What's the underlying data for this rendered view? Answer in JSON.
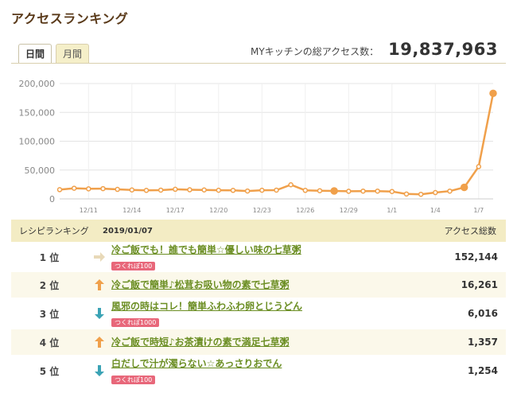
{
  "page": {
    "title": "アクセスランキング"
  },
  "tabs": [
    {
      "label": "日間",
      "active": true
    },
    {
      "label": "月間",
      "active": false
    }
  ],
  "total": {
    "label": "MYキッチンの総アクセス数：",
    "value": "19,837,963"
  },
  "chart_data": {
    "type": "line",
    "title": "",
    "xlabel": "",
    "ylabel": "",
    "ylim": [
      0,
      200000
    ],
    "yticks": [
      "0",
      "50,000",
      "100,000",
      "150,000",
      "200,000"
    ],
    "xtick_labels": [
      "12/11",
      "12/14",
      "12/17",
      "12/20",
      "12/23",
      "12/26",
      "12/29",
      "1/1",
      "1/4",
      "1/7"
    ],
    "x": [
      "12/9",
      "12/10",
      "12/11",
      "12/12",
      "12/13",
      "12/14",
      "12/15",
      "12/16",
      "12/17",
      "12/18",
      "12/19",
      "12/20",
      "12/21",
      "12/22",
      "12/23",
      "12/24",
      "12/25",
      "12/26",
      "12/27",
      "12/28",
      "12/29",
      "12/30",
      "12/31",
      "1/1",
      "1/2",
      "1/3",
      "1/4",
      "1/5",
      "1/6",
      "1/7"
    ],
    "series": [
      {
        "values": [
          16000,
          18500,
          17500,
          17800,
          16500,
          15500,
          14800,
          15200,
          16700,
          15800,
          15500,
          15000,
          14800,
          13700,
          15000,
          15200,
          24500,
          14800,
          14200,
          13800,
          13200,
          13500,
          13500,
          12800,
          8500,
          8000,
          11000,
          13500,
          20000,
          56000,
          183000
        ]
      }
    ],
    "highlight_points": [
      19,
      28
    ],
    "color": "#f0a04b",
    "grid": true
  },
  "ranking": {
    "header_title": "レシピランキング",
    "date": "2019/01/07",
    "count_header": "アクセス総数",
    "rows": [
      {
        "rank": "1 位",
        "trend": "same",
        "title": "冷ご飯でも！誰でも簡単☆優しい味の七草粥",
        "badge": "つくれぽ100",
        "count": "152,144"
      },
      {
        "rank": "2 位",
        "trend": "up",
        "title": "冷ご飯で簡単♪松茸お吸い物の素で七草粥",
        "badge": "",
        "count": "16,261"
      },
      {
        "rank": "3 位",
        "trend": "down",
        "title": "風邪の時はコレ！簡単ふわふわ卵とじうどん",
        "badge": "つくれぽ1000",
        "count": "6,016"
      },
      {
        "rank": "4 位",
        "trend": "up",
        "title": "冷ご飯で時短♪お茶漬けの素で満足七草粥",
        "badge": "",
        "count": "1,357"
      },
      {
        "rank": "5 位",
        "trend": "down",
        "title": "白だしで汁が濁らない☆あっさりおでん",
        "badge": "つくれぽ100",
        "count": "1,254"
      }
    ]
  },
  "colors": {
    "accent": "#f0a04b",
    "link": "#6b8e23",
    "badge": "#e8677a",
    "up": "#f0a04b",
    "down": "#3ba3b5",
    "same": "#e8d9b8"
  }
}
